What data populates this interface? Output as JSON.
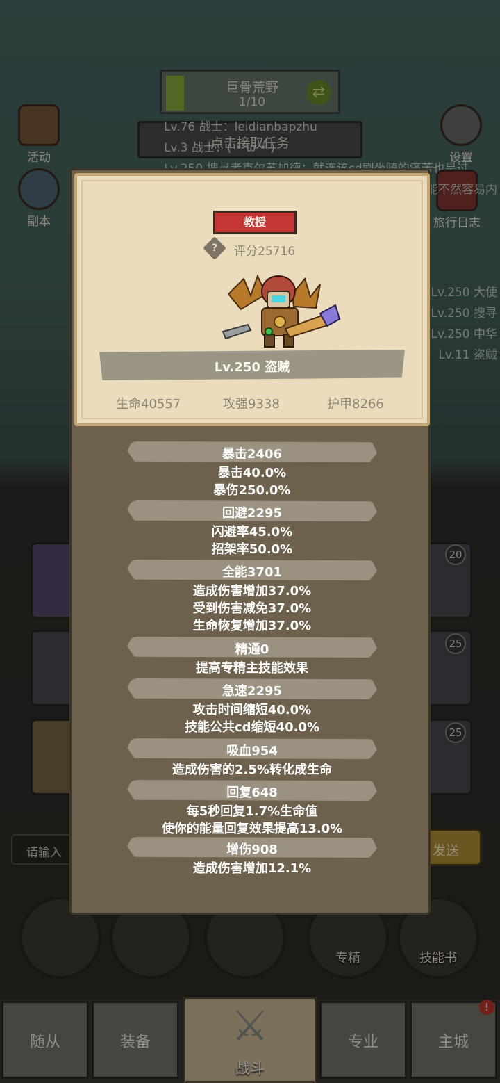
{
  "map": {
    "name": "巨骨荒野",
    "progress": "1/10"
  },
  "task_button": {
    "label": "点击接取任务"
  },
  "chat_lines": [
    "Lv.76 战士：leidianbapzhu",
    "Lv.3 战士：( •̀ ω •́ )",
    "Lv.250 搜寻者克尔苏加德：就连该cd刷坐骑的痛苦也是过"
  ],
  "left_menu": [
    {
      "label": "活动",
      "icon": "scroll-icon"
    },
    {
      "label": "副本",
      "icon": "portal-icon"
    }
  ],
  "right_menu": [
    {
      "label": "设置",
      "icon": "gear-icon"
    },
    {
      "label": "旅行日志",
      "icon": "book-icon"
    }
  ],
  "side_log": [
    "能不然容易内",
    "Lv.250 大使",
    "Lv.250 搜寻",
    "Lv.250 中华",
    "Lv.11 盗贼"
  ],
  "slot_levels": [
    "20",
    "25",
    "25"
  ],
  "input": {
    "placeholder": "请输入"
  },
  "send_button": {
    "label": "发送"
  },
  "round_buttons": [
    {
      "label": "",
      "icon": "potion-icon"
    },
    {
      "label": "",
      "icon": "bread-icon"
    },
    {
      "label": "",
      "icon": "chest-icon"
    },
    {
      "label": "专精",
      "icon": "target-icon"
    },
    {
      "label": "技能书",
      "icon": "skillbook-icon"
    }
  ],
  "nav": {
    "tabs": [
      "随从",
      "装备",
      "战斗",
      "专业",
      "主城"
    ],
    "active": "战斗",
    "alert": "!"
  },
  "character": {
    "title": "教授",
    "score": "评分25716",
    "name": "Lv.250 盗贼",
    "hp": "生命40557",
    "attack": "攻强9338",
    "armor": "护甲8266"
  },
  "stat_groups": [
    {
      "header": "暴击2406",
      "lines": [
        "暴击40.0%",
        "暴伤250.0%"
      ]
    },
    {
      "header": "回避2295",
      "lines": [
        "闪避率45.0%",
        "招架率50.0%"
      ]
    },
    {
      "header": "全能3701",
      "lines": [
        "造成伤害增加37.0%",
        "受到伤害减免37.0%",
        "生命恢复增加37.0%"
      ]
    },
    {
      "header": "精通0",
      "lines": [
        "提高专精主技能效果"
      ]
    },
    {
      "header": "急速2295",
      "lines": [
        "攻击时间缩短40.0%",
        "技能公共cd缩短40.0%"
      ]
    },
    {
      "header": "吸血954",
      "lines": [
        "造成伤害的2.5%转化成生命"
      ]
    },
    {
      "header": "回复648",
      "lines": [
        "每5秒回复1.7%生命值",
        "使你的能量回复效果提高13.0%"
      ]
    },
    {
      "header": "增伤908",
      "lines": [
        "造成伤害增加12.1%"
      ]
    }
  ]
}
